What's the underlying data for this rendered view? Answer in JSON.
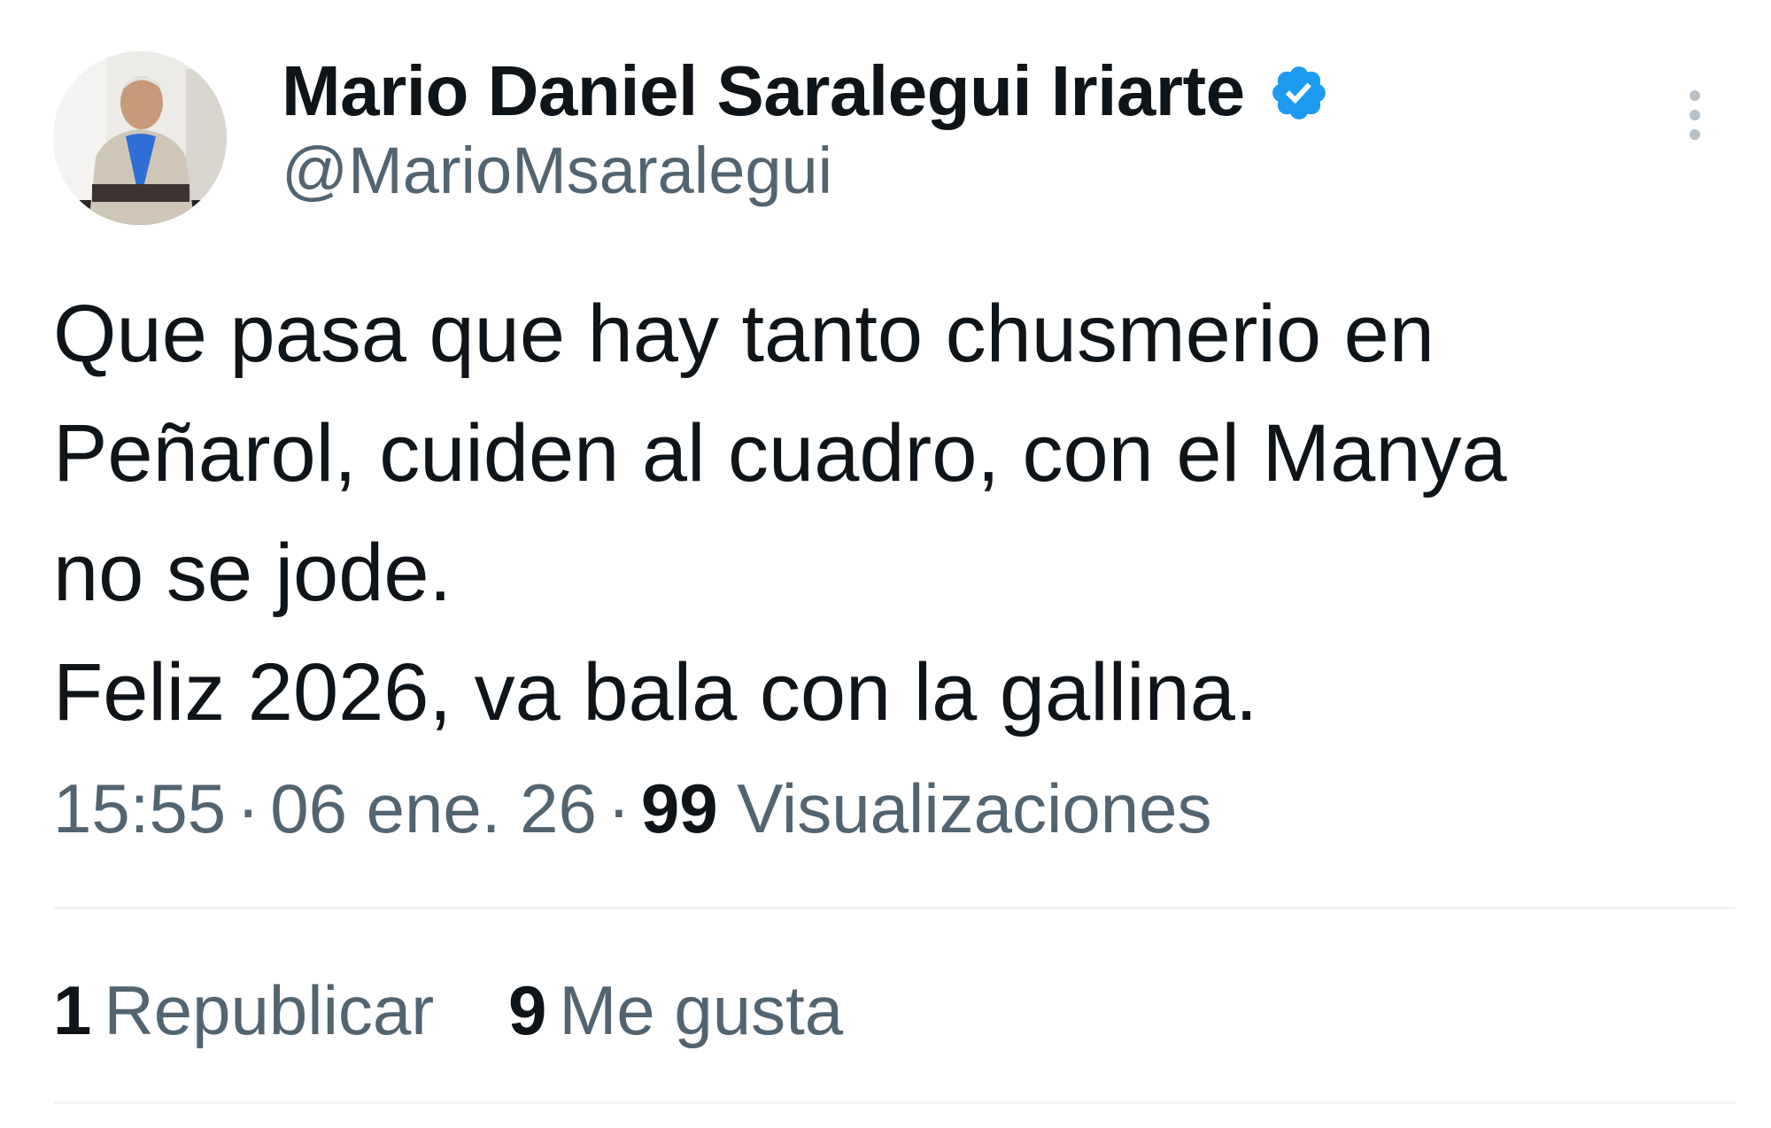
{
  "author": {
    "display_name": "Mario Daniel Saralegui Iriarte",
    "handle": "@MarioMsaralegui",
    "verified": true,
    "verified_color": "#1d9bf0"
  },
  "tweet": {
    "lines": [
      "Que pasa que hay tanto chusmerio en",
      "Peñarol, cuiden al cuadro, con el Manya",
      "no se jode.",
      "Feliz 2026, va bala con la gallina."
    ]
  },
  "meta": {
    "time": "15:55",
    "separator": "·",
    "date": "06 ene. 26",
    "views_count": "99",
    "views_label": "Visualizaciones"
  },
  "stats": {
    "reposts_count": "1",
    "reposts_label": "Republicar",
    "likes_count": "9",
    "likes_label": "Me gusta"
  },
  "icons": {
    "more": "more-vertical-icon",
    "verified": "verified-badge-icon"
  }
}
